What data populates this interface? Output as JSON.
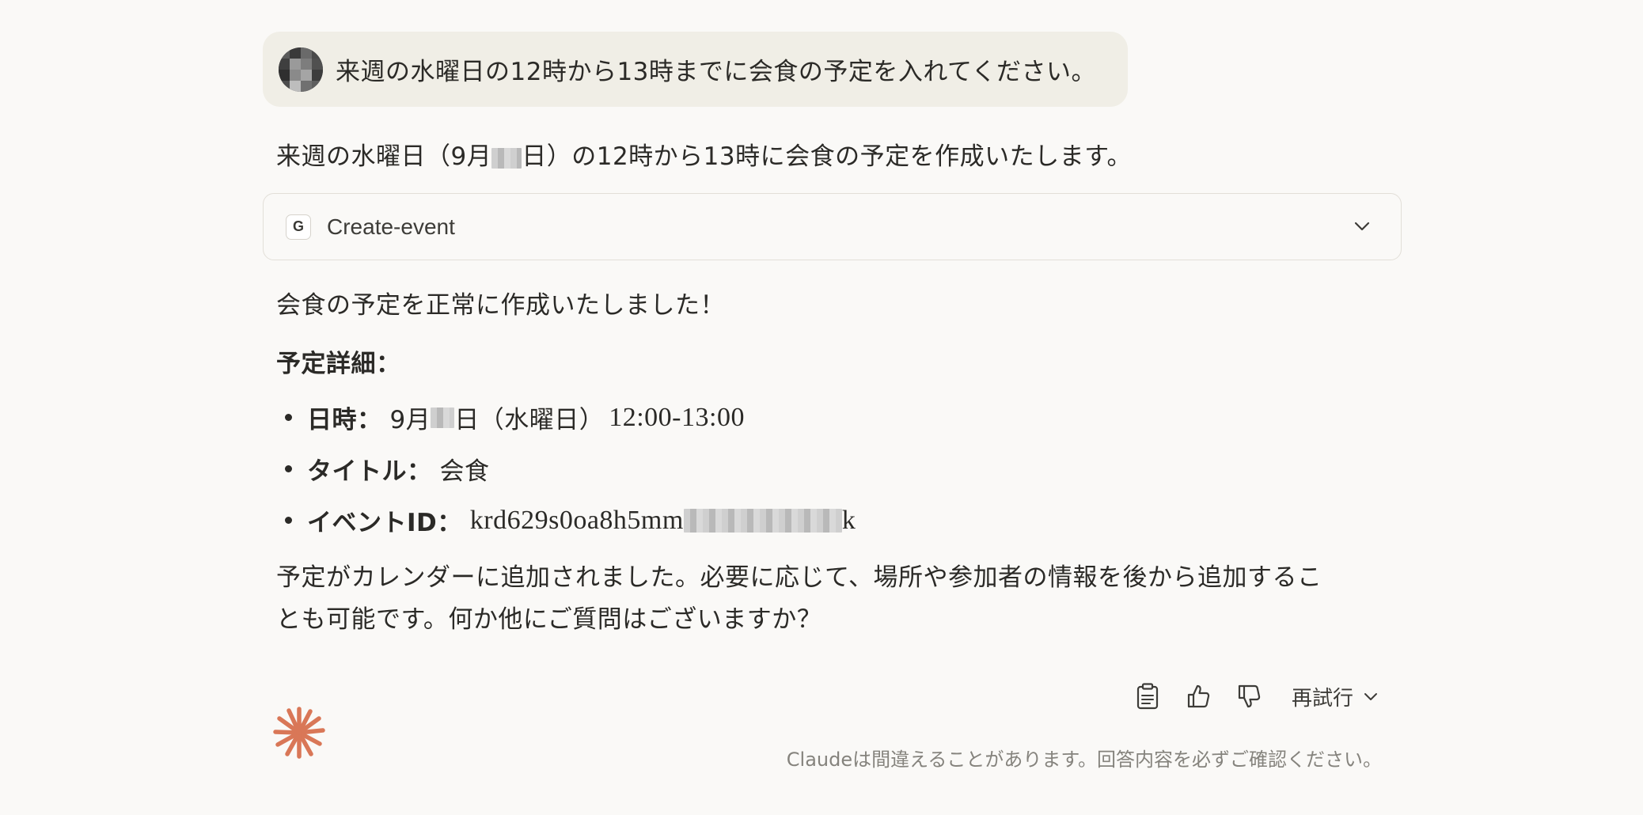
{
  "user_message": {
    "text": "来週の水曜日の12時から13時までに会食の予定を入れてください。"
  },
  "assistant": {
    "intro_before": "来週の水曜日（9月",
    "intro_after": "日）の12時から13時に会食の予定を作成いたします。",
    "tool": {
      "icon_letter": "G",
      "name": "Create-event",
      "icon": "chevron-down-icon"
    },
    "success": "会食の予定を正常に作成いたしました！",
    "details_heading": "予定詳細：",
    "details": {
      "datetime_label": "日時：",
      "datetime_month": "9月",
      "datetime_rest": "日（水曜日）",
      "datetime_time": "12:00-13:00",
      "title_label": "タイトル：",
      "title_value": "会食",
      "eventid_label": "イベントID：",
      "eventid_value": "krd629s0oa8h5mm",
      "eventid_tail": "k"
    },
    "closing": "予定がカレンダーに追加されました。必要に応じて、場所や参加者の情報を後から追加することも可能です。何か他にご質問はございますか？"
  },
  "actions": {
    "copy_icon": "clipboard-icon",
    "like_icon": "thumbs-up-icon",
    "dislike_icon": "thumbs-down-icon",
    "retry_label": "再試行",
    "retry_icon": "chevron-down-icon"
  },
  "footer": {
    "logo_icon": "claude-starburst-icon",
    "disclaimer": "Claudeは間違えることがあります。回答内容を必ずご確認ください。"
  },
  "colors": {
    "background": "#faf9f7",
    "user_bubble": "#f0eee6",
    "logo": "#d97757",
    "text": "#2b2a27",
    "muted": "#85837d"
  }
}
